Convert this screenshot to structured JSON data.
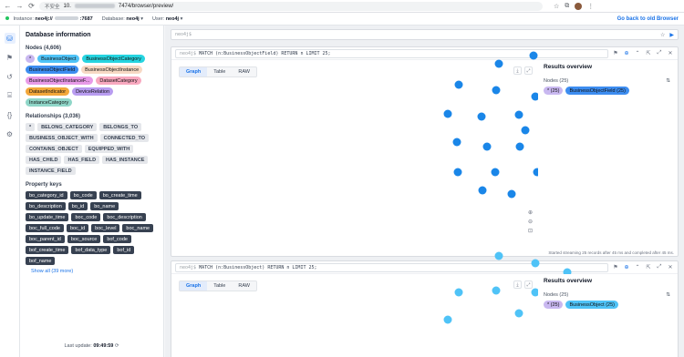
{
  "browser": {
    "insecure_label": "不安全",
    "url_host": "10.",
    "url_port": ":7687",
    "url_path": "7474/browser/preview/",
    "nav_back": "←",
    "nav_forward": "→",
    "nav_reload": "⟳"
  },
  "appbar": {
    "instance_label": "Instance:",
    "instance_value": "neo4j://",
    "database_label": "Database:",
    "database_value": "neo4j",
    "user_label": "User:",
    "user_value": "neo4j",
    "old_browser_link": "Go back to old Browser"
  },
  "colors": {
    "accent": "#1a73e8",
    "node_business_object_field": "#1a86e8",
    "node_business_object": "#4fc3f7"
  },
  "rail": [
    {
      "icon": "database-icon",
      "glyph": "⛁",
      "active": true
    },
    {
      "icon": "bookmark-icon",
      "glyph": "⚑",
      "active": false
    },
    {
      "icon": "history-icon",
      "glyph": "↺",
      "active": false
    },
    {
      "icon": "book-icon",
      "glyph": "⌸",
      "active": false
    },
    {
      "icon": "braces-icon",
      "glyph": "{}",
      "active": false
    },
    {
      "icon": "settings-icon",
      "glyph": "⚙",
      "active": false
    }
  ],
  "db": {
    "title": "Database information",
    "nodes_title": "Nodes (4,606)",
    "node_labels": [
      {
        "label": "*",
        "color": "#c9b8f0"
      },
      {
        "label": "BusinessObject",
        "color": "#4fc3f7"
      },
      {
        "label": "BusinessObjectCategory",
        "color": "#26d4e0"
      },
      {
        "label": "BusinessObjectField",
        "color": "#3d8df0"
      },
      {
        "label": "BusinessObjectInstance",
        "color": "#f7d9c4"
      },
      {
        "label": "BusinessObjectInstanceF...",
        "color": "#e89ae8"
      },
      {
        "label": "DatasetCategory",
        "color": "#f8a8bf"
      },
      {
        "label": "DatasetIndicator",
        "color": "#f3a73a"
      },
      {
        "label": "DeviceRelation",
        "color": "#b89cf0"
      },
      {
        "label": "InstanceCategory",
        "color": "#8fd6c8"
      }
    ],
    "rels_title": "Relationships (3,036)",
    "relationships": [
      "*",
      "BELONG_CATEGORY",
      "BELONGS_TO",
      "BUSINESS_OBJECT_WITH",
      "CONNECTED_TO",
      "CONTAINS_OBJECT",
      "EQUIPPED_WITH",
      "HAS_CHILD",
      "HAS_FIELD",
      "HAS_INSTANCE",
      "INSTANCE_FIELD"
    ],
    "keys_title": "Property keys",
    "property_keys": [
      "bo_category_id",
      "bo_code",
      "bo_create_time",
      "bo_description",
      "bo_id",
      "bo_name",
      "bo_update_time",
      "boc_code",
      "boc_description",
      "boc_full_code",
      "boc_id",
      "boc_level",
      "boc_name",
      "boc_parent_id",
      "boc_source",
      "bof_code",
      "bof_create_time",
      "bof_data_type",
      "bof_id",
      "bof_name"
    ],
    "show_all": "Show all (39 more)",
    "last_update_label": "Last update:",
    "last_update_time": "09:49:59"
  },
  "editor": {
    "prompt": "neo4j$"
  },
  "frames": [
    {
      "query": "MATCH (n:BusinessObjectField) RETURN n LIMIT 25;",
      "prompt": "neo4j$",
      "tabs": [
        "Graph",
        "Table",
        "RAW"
      ],
      "overview_title": "Results overview",
      "overview_sub": "Nodes (25)",
      "overview_chips": [
        {
          "label": "* (25)",
          "color": "#c9b8f0"
        },
        {
          "label": "BusinessObjectField (25)",
          "color": "#3d8df0"
        }
      ],
      "status": "Started streaming 25 records after 45 ms and completed after 45 ms."
    },
    {
      "query": "MATCH (n:BusinessObject) RETURN n LIMIT 25;",
      "prompt": "neo4j$",
      "tabs": [
        "Graph",
        "Table",
        "RAW"
      ],
      "overview_title": "Results overview",
      "overview_sub": "Nodes (25)",
      "overview_chips": [
        {
          "label": "* (25)",
          "color": "#c9b8f0"
        },
        {
          "label": "BusinessObject (25)",
          "color": "#4fc3f7"
        }
      ]
    }
  ]
}
